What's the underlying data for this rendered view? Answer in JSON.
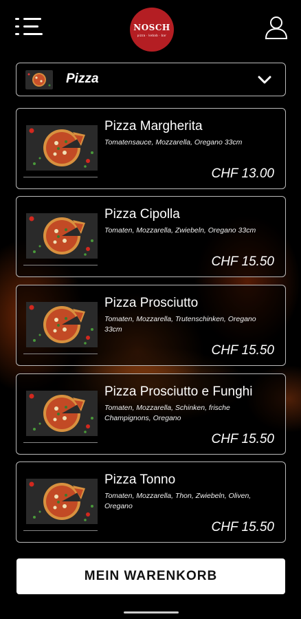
{
  "header": {
    "logo_text": "NOSCH",
    "logo_subtext": "pizza · kebab · bar"
  },
  "category": {
    "label": "Pizza"
  },
  "items": [
    {
      "name": "Pizza Margherita",
      "desc": "Tomatensauce, Mozzarella, Oregano 33cm",
      "price": "CHF 13.00"
    },
    {
      "name": "Pizza Cipolla",
      "desc": "Tomaten, Mozzarella, Zwiebeln, Oregano 33cm",
      "price": "CHF 15.50"
    },
    {
      "name": "Pizza Prosciutto",
      "desc": "Tomaten, Mozzarella, Trutenschinken, Oregano 33cm",
      "price": "CHF 15.50"
    },
    {
      "name": "Pizza Prosciutto e Funghi",
      "desc": "Tomaten, Mozzarella, Schinken, frische Champignons, Oregano",
      "price": "CHF 15.50"
    },
    {
      "name": "Pizza Tonno",
      "desc": "Tomaten, Mozzarella, Thon, Zwiebeln, Oliven, Oregano",
      "price": "CHF 15.50"
    }
  ],
  "cart": {
    "label": "MEIN WARENKORB"
  },
  "colors": {
    "background": "#000000",
    "logo_red": "#b41e23",
    "button_bg": "#ffffff"
  }
}
